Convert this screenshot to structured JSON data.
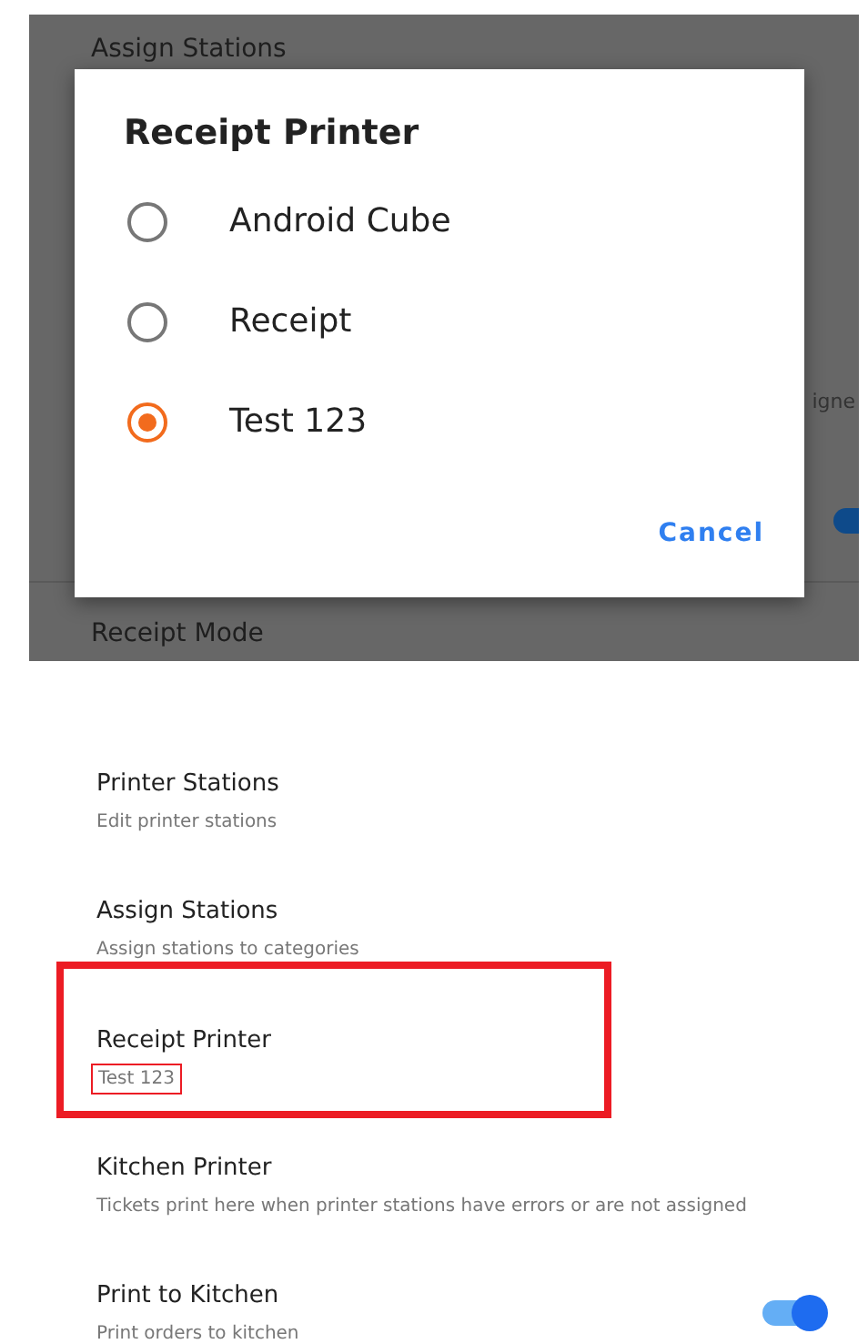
{
  "background_screen": {
    "top_title": "Assign Stations",
    "cut_text": "igne",
    "switch_on": true,
    "bottom_title": "Receipt Mode"
  },
  "dialog": {
    "title": "Receipt Printer",
    "options": [
      {
        "label": "Android Cube",
        "selected": false
      },
      {
        "label": "Receipt",
        "selected": false
      },
      {
        "label": "Test 123",
        "selected": true
      }
    ],
    "button": "Cancel"
  },
  "settings": {
    "items": [
      {
        "kind": "text",
        "title": "Printer Stations",
        "summary": "Edit printer stations",
        "highlighted": false,
        "summary_highlighted": false
      },
      {
        "kind": "text",
        "title": "Assign Stations",
        "summary": "Assign stations to categories",
        "highlighted": false,
        "summary_highlighted": false
      },
      {
        "kind": "text",
        "title": "Receipt Printer",
        "summary": "Test 123",
        "highlighted": true,
        "summary_highlighted": true
      },
      {
        "kind": "text",
        "title": "Kitchen Printer",
        "summary": "Tickets print here when printer stations have errors or are not assigned",
        "highlighted": false,
        "summary_highlighted": false
      },
      {
        "kind": "switch",
        "title": "Print to Kitchen",
        "summary": "Print orders to kitchen",
        "highlighted": false,
        "summary_highlighted": false,
        "on": true
      }
    ]
  }
}
